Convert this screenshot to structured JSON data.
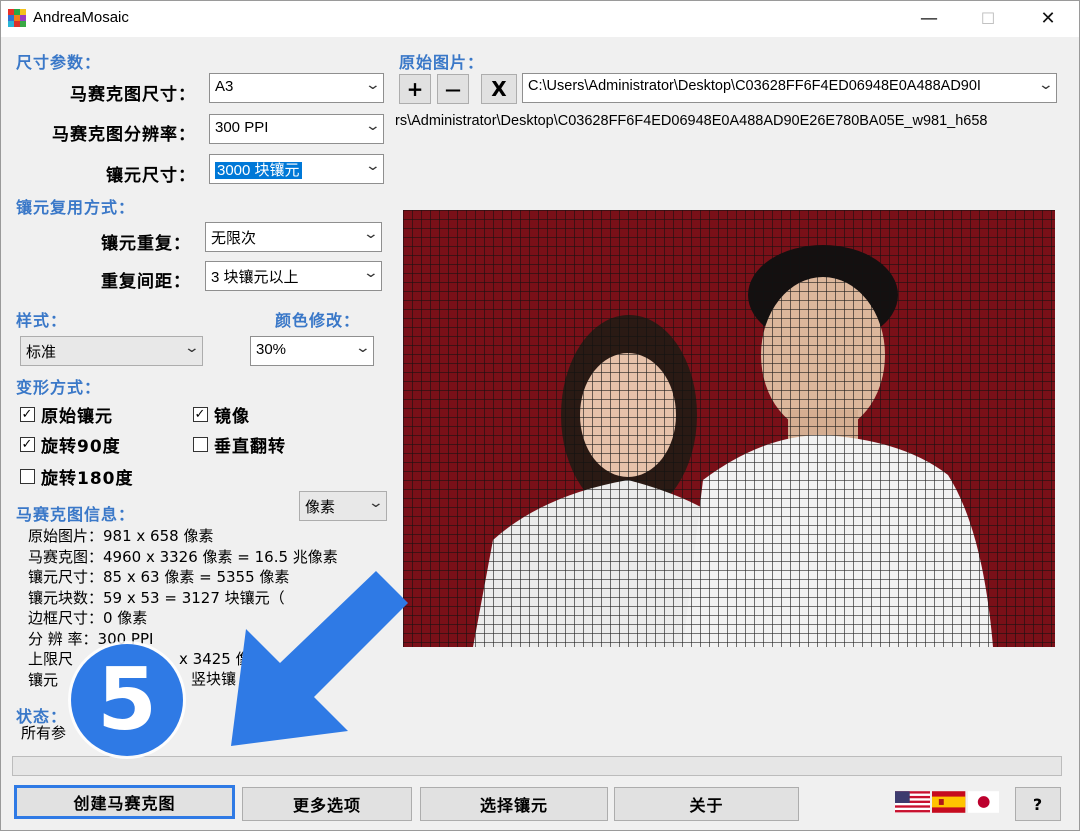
{
  "window": {
    "title": "AndreaMosaic",
    "minimize": "—",
    "maximize": "☐",
    "close": "✕"
  },
  "size_params": {
    "heading": "尺寸参数：",
    "mosaic_size_label": "马赛克图尺寸：",
    "mosaic_size_value": "A3",
    "resolution_label": "马赛克图分辨率：",
    "resolution_value": "300 PPI",
    "tile_size_label": "镶元尺寸：",
    "tile_size_value": "3000 块镶元"
  },
  "reuse": {
    "heading": "镶元复用方式：",
    "repeat_label": "镶元重复：",
    "repeat_value": "无限次",
    "spacing_label": "重复间距：",
    "spacing_value": "3  块镶元以上"
  },
  "style": {
    "heading": "样式：",
    "value": "标准"
  },
  "color": {
    "heading": "颜色修改：",
    "value": "30%"
  },
  "transform": {
    "heading": "变形方式：",
    "options": [
      {
        "label": "原始镶元",
        "checked": true
      },
      {
        "label": "镜像",
        "checked": true
      },
      {
        "label": "旋转90度",
        "checked": true
      },
      {
        "label": "垂直翻转",
        "checked": false
      },
      {
        "label": "旋转180度",
        "checked": false
      }
    ]
  },
  "info": {
    "heading": "马赛克图信息：",
    "unit": "像素",
    "lines": [
      "原始图片：981 x 658 像素",
      "马赛克图：4960 x 3326 像素 = 16.5 兆像素",
      "镶元尺寸：85 x 63 像素 = 5355 像素",
      "镶元块数：59 x 53 = 3127 块镶元（",
      "边框尺寸：0 像素",
      "分 辨 率：300 PPI",
      "上限尺",
      "镶元"
    ],
    "line7_tail": "x 3425 像",
    "line8_tail": "竖块镶"
  },
  "status": {
    "heading": "状态：",
    "text": "所有参"
  },
  "source": {
    "heading": "原始图片：",
    "add": "+",
    "remove": "—",
    "clear": "X",
    "path": "C:\\Users\\Administrator\\Desktop\\C03628FF6F4ED06948E0A488AD90I",
    "path_full": "rs\\Administrator\\Desktop\\C03628FF6F4ED06948E0A488AD90E26E780BA05E_w981_h658"
  },
  "buttons": {
    "create": "创建马赛克图",
    "more": "更多选项",
    "select": "选择镶元",
    "about": "关于",
    "help": "?"
  },
  "step_badge": "5",
  "colors": {
    "accent": "#3a78c8",
    "arrow": "#2f7ae5",
    "highlight": "#2f7ae5",
    "preview_bg": "#7a1018"
  }
}
